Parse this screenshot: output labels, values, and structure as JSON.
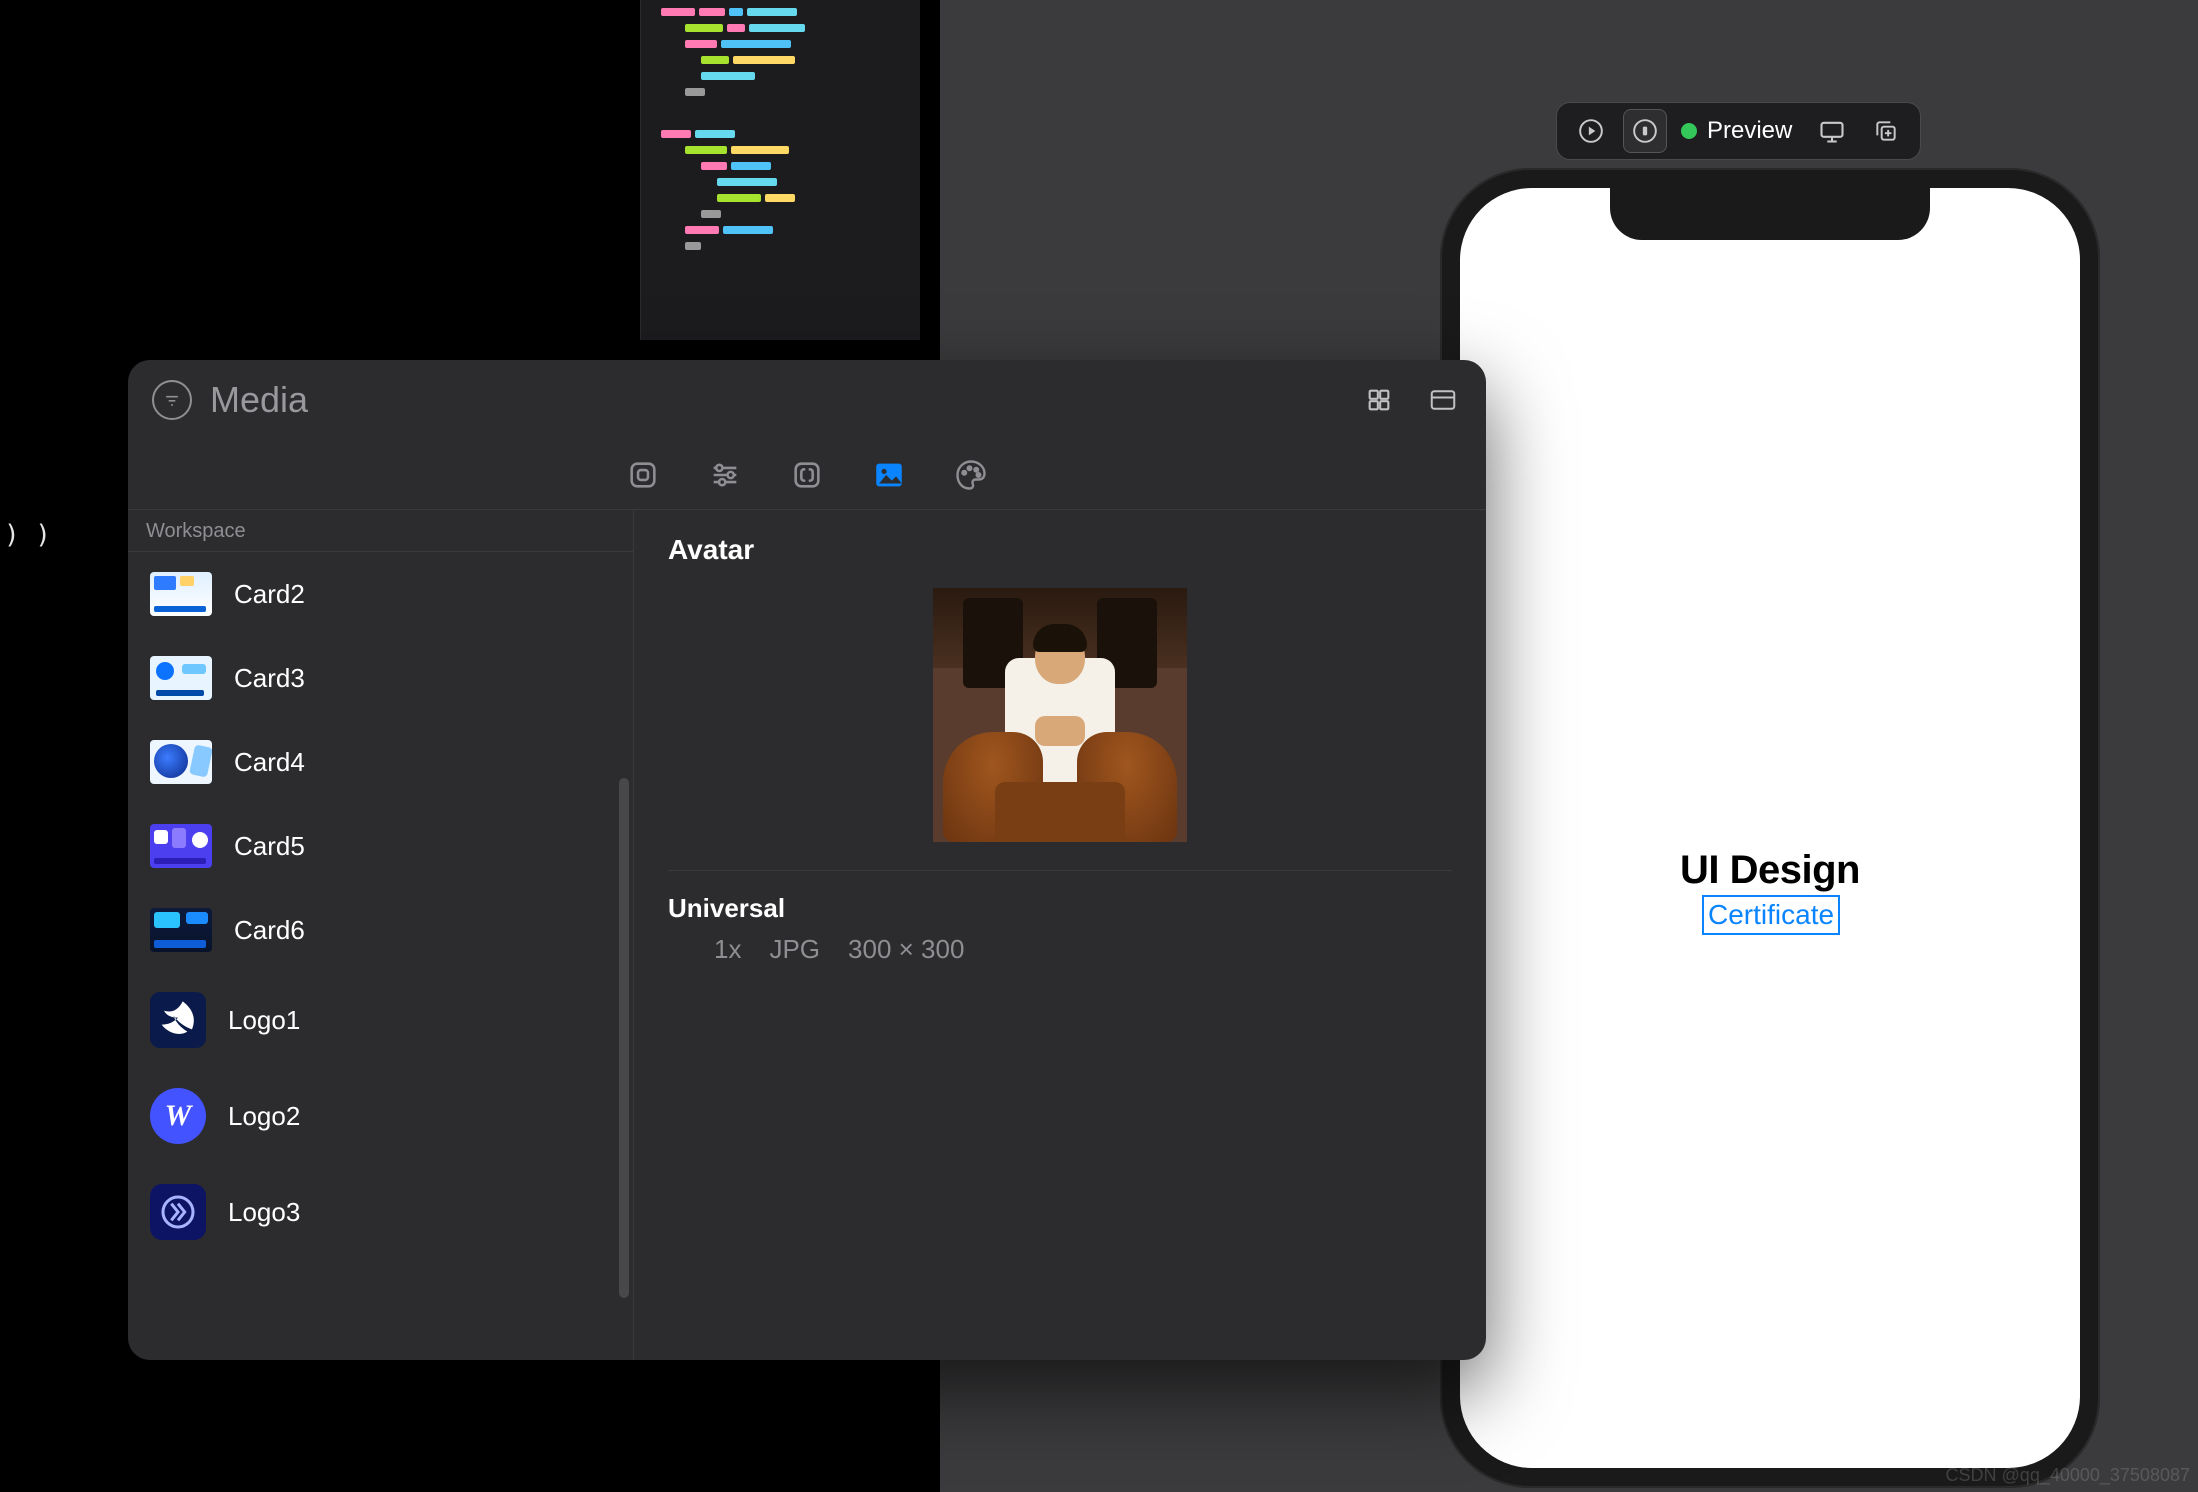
{
  "code_editor": {
    "trailing_text": ") )"
  },
  "preview_toolbar": {
    "label": "Preview",
    "status_color": "#34c759"
  },
  "device_preview": {
    "heading": "UI Design",
    "badge": "Certificate"
  },
  "media_library": {
    "title": "Media",
    "sidebar_section": "Workspace",
    "assets": [
      {
        "name": "Card2"
      },
      {
        "name": "Card3"
      },
      {
        "name": "Card4"
      },
      {
        "name": "Card5"
      },
      {
        "name": "Card6"
      },
      {
        "name": "Logo1"
      },
      {
        "name": "Logo2"
      },
      {
        "name": "Logo3"
      }
    ],
    "detail": {
      "title": "Avatar",
      "scale_section": "Universal",
      "scale": "1x",
      "format": "JPG",
      "dimensions": "300 × 300"
    }
  },
  "watermark": "CSDN @qq_40000_37508087"
}
